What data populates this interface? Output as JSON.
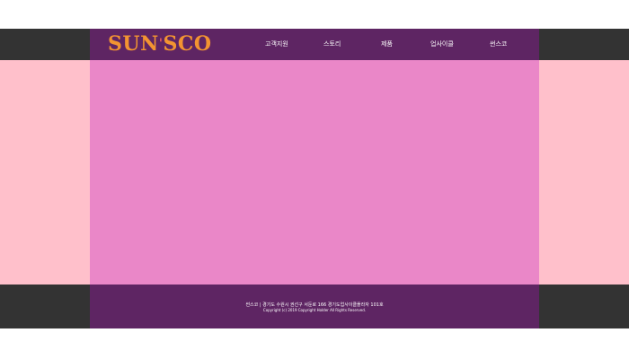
{
  "header": {
    "logo": {
      "text_before": "SUN",
      "text_after": "SCO",
      "apostrophe": "'",
      "color": "#f39431"
    },
    "nav": [
      {
        "label": "고객지원"
      },
      {
        "label": "스토리"
      },
      {
        "label": "제품"
      },
      {
        "label": "업사이클"
      },
      {
        "label": "썬스코"
      }
    ]
  },
  "footer": {
    "address": "썬스코 | 경기도 수원시 권선구 서둔로 166 경기도업사이클플라자 101호",
    "copyright": "Copyright (c) 2019 Copyright Holder All Rights Reserved."
  },
  "colors": {
    "outer_dark": "#333333",
    "header_footer_purple": "#5e2563",
    "main_pink": "#ea87c8",
    "side_pink": "#ffc0cb",
    "logo_orange": "#f39431"
  }
}
